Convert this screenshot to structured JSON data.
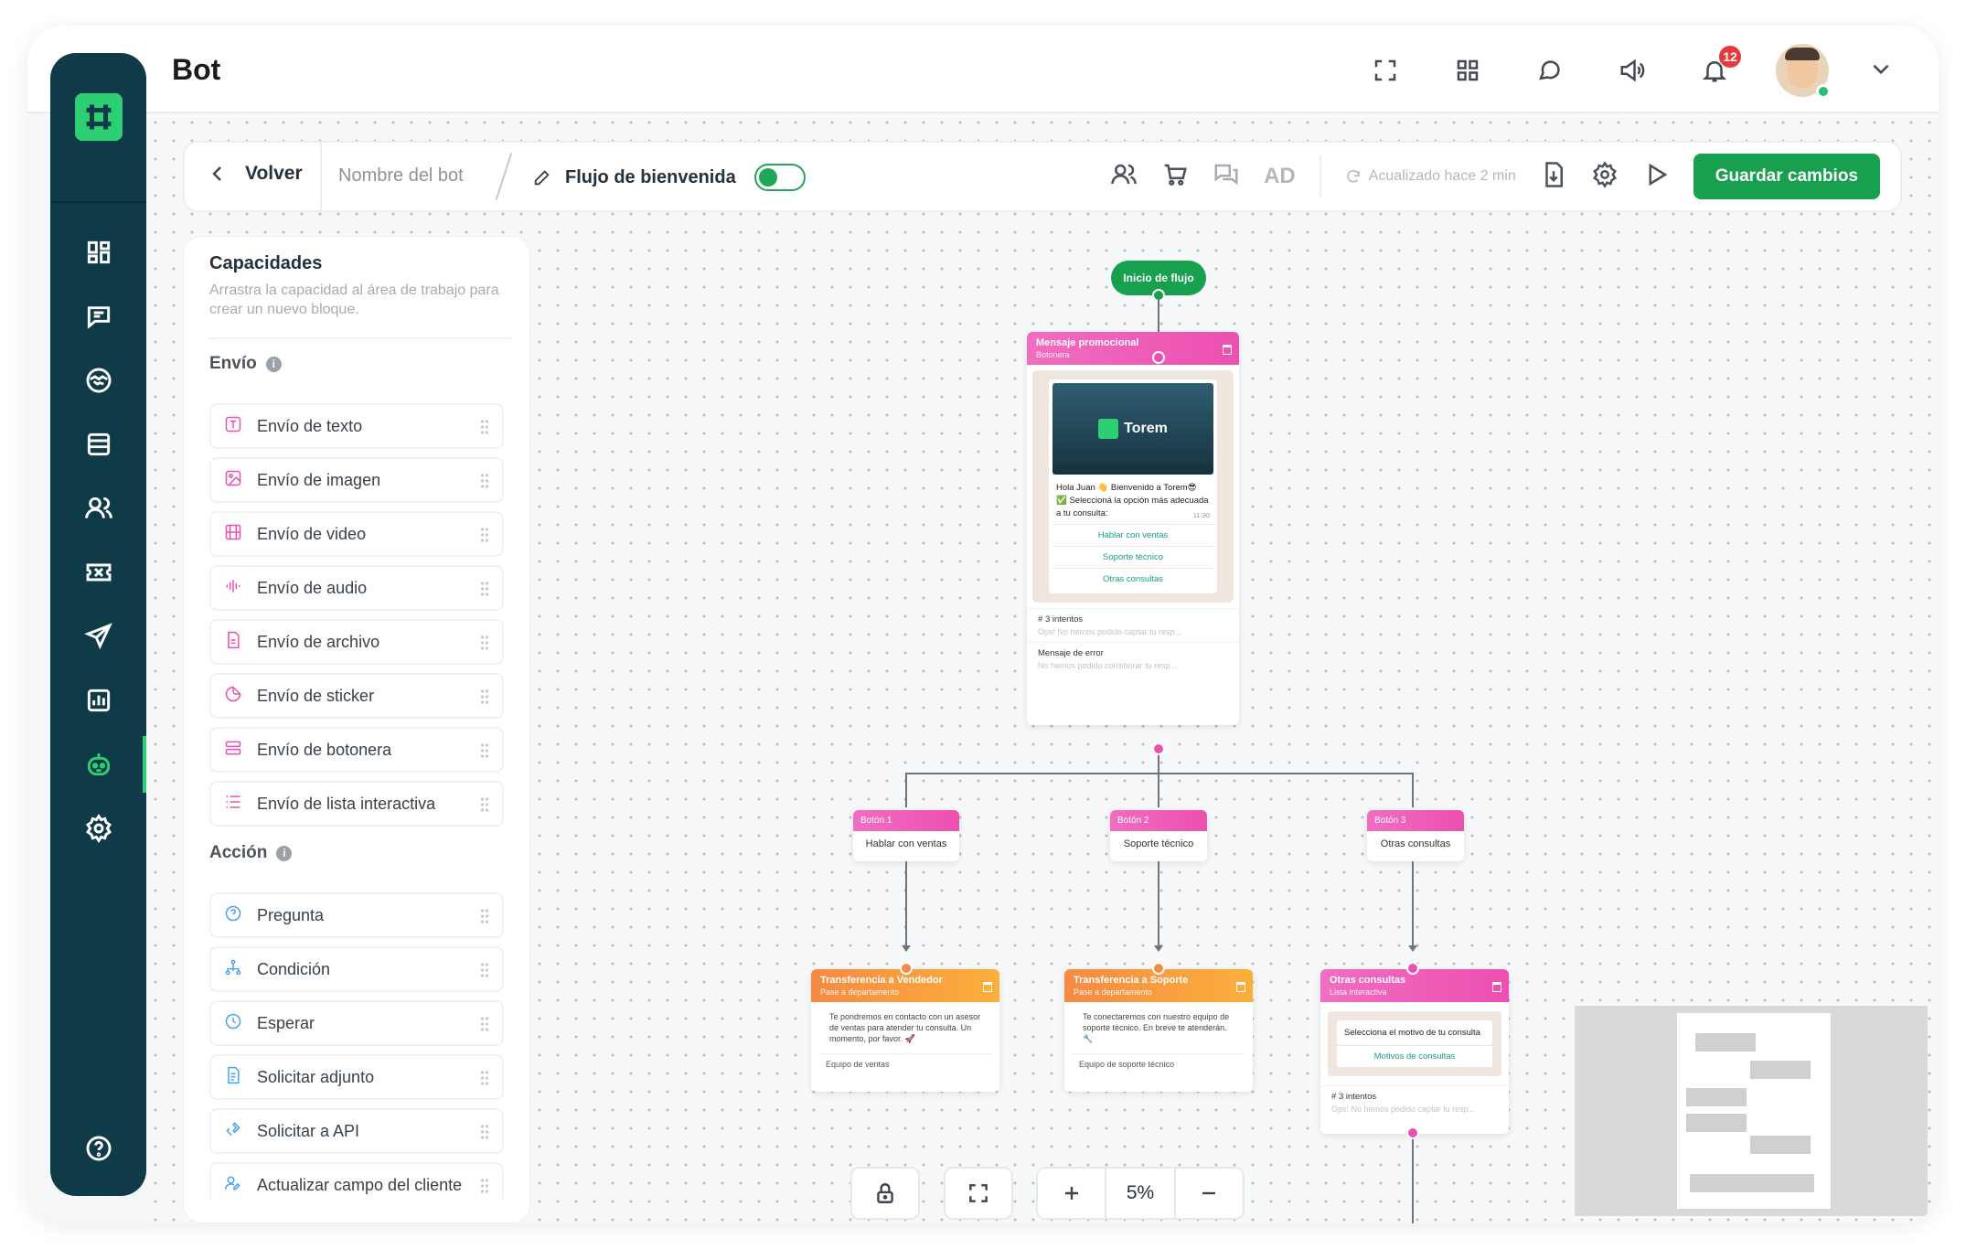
{
  "app": {
    "title": "Bot"
  },
  "topbar": {
    "icons": [
      "fullscreen-icon",
      "grid-icon",
      "chat-icon",
      "megaphone-icon",
      "bell-icon"
    ],
    "notifications_count": "12"
  },
  "sidebar": {
    "items": [
      "dashboard",
      "messages",
      "handshake",
      "list",
      "contacts",
      "tickets",
      "send",
      "reports",
      "bot",
      "settings"
    ],
    "active": "bot",
    "help_icon": "question-icon"
  },
  "toolbar": {
    "back_label": "Volver",
    "bot_name_placeholder": "Nombre del bot",
    "flow_name": "Flujo de bienvenida",
    "flow_enabled": true,
    "ad_label": "AD",
    "updated_label": "Acualizado hace 2 min",
    "save_label": "Guardar cambios"
  },
  "capabilities": {
    "title": "Capacidades",
    "subtitle": "Arrastra la capacidad al área de trabajo para crear un nuevo bloque.",
    "sections": [
      {
        "title": "Envío",
        "items": [
          {
            "label": "Envío de texto",
            "icon": "text-icon",
            "color": "#ec4fb0"
          },
          {
            "label": "Envío de imagen",
            "icon": "image-icon",
            "color": "#ec4fb0"
          },
          {
            "label": "Envío de video",
            "icon": "video-icon",
            "color": "#ec4fb0"
          },
          {
            "label": "Envío de audio",
            "icon": "audio-icon",
            "color": "#ec4fb0"
          },
          {
            "label": "Envío de archivo",
            "icon": "file-icon",
            "color": "#ec4fb0"
          },
          {
            "label": "Envío de sticker",
            "icon": "sticker-icon",
            "color": "#ec4fb0"
          },
          {
            "label": "Envío de botonera",
            "icon": "buttons-icon",
            "color": "#ec4fb0"
          },
          {
            "label": "Envío de lista interactiva",
            "icon": "list-icon",
            "color": "#ec4fb0"
          }
        ]
      },
      {
        "title": "Acción",
        "items": [
          {
            "label": "Pregunta",
            "icon": "question-icon",
            "color": "#4aa3f0"
          },
          {
            "label": "Condición",
            "icon": "condition-icon",
            "color": "#4aa3f0"
          },
          {
            "label": "Esperar",
            "icon": "clock-icon",
            "color": "#4aa3f0"
          },
          {
            "label": "Solicitar adjunto",
            "icon": "attachment-icon",
            "color": "#4aa3f0"
          },
          {
            "label": "Solicitar a API",
            "icon": "api-icon",
            "color": "#4aa3f0"
          },
          {
            "label": "Actualizar campo del cliente",
            "icon": "user-edit-icon",
            "color": "#4aa3f0"
          }
        ]
      }
    ]
  },
  "flow": {
    "start_label": "Inicio de flujo",
    "promo": {
      "title": "Mensaje promocional",
      "subtitle": "Botonera",
      "brand": "Torem",
      "message": "Hola Juan 👋 Bienvenido a Torem😎 ✅ Seleccioná la opción más adecuada a tu consulta:",
      "time": "11:30",
      "buttons": [
        "Hablar con ventas",
        "Soporte técnico",
        "Otras consultas"
      ],
      "attempts": "3 intentos",
      "attempts_msg": "Ops! No hemos podido captar tu resp...",
      "error_title": "Mensaje de error",
      "error_msg": "No hemos podido corroborar tu resp..."
    },
    "button_nodes": [
      {
        "title": "Botón 1",
        "text": "Hablar con ventas"
      },
      {
        "title": "Botón 2",
        "text": "Soporte técnico"
      },
      {
        "title": "Botón 3",
        "text": "Otras consultas"
      }
    ],
    "transfer_nodes": [
      {
        "title": "Transferencia a Vendedor",
        "subtitle": "Pase a departamento",
        "text": "Te pondremos en contacto con un asesor de ventas para atender tu consulta. Un momento, por favor. 🚀",
        "footer": "Equipo de ventas"
      },
      {
        "title": "Transferencia a Soporte",
        "subtitle": "Pase a departamento",
        "text": "Te conectaremos con nuestro equipo de soporte técnico. En breve te atenderán. 🔧",
        "footer": "Equipo de soporte técnico"
      }
    ],
    "list_node": {
      "title": "Otras consultas",
      "subtitle": "Lista interactiva",
      "prompt": "Selecciona el motivo de tu consulta",
      "button": "Motivos de consultas",
      "attempts": "3 intentos",
      "attempts_msg": "Ops! No hemos podido captar tu resp..."
    }
  },
  "zoom": {
    "value": "5%"
  }
}
